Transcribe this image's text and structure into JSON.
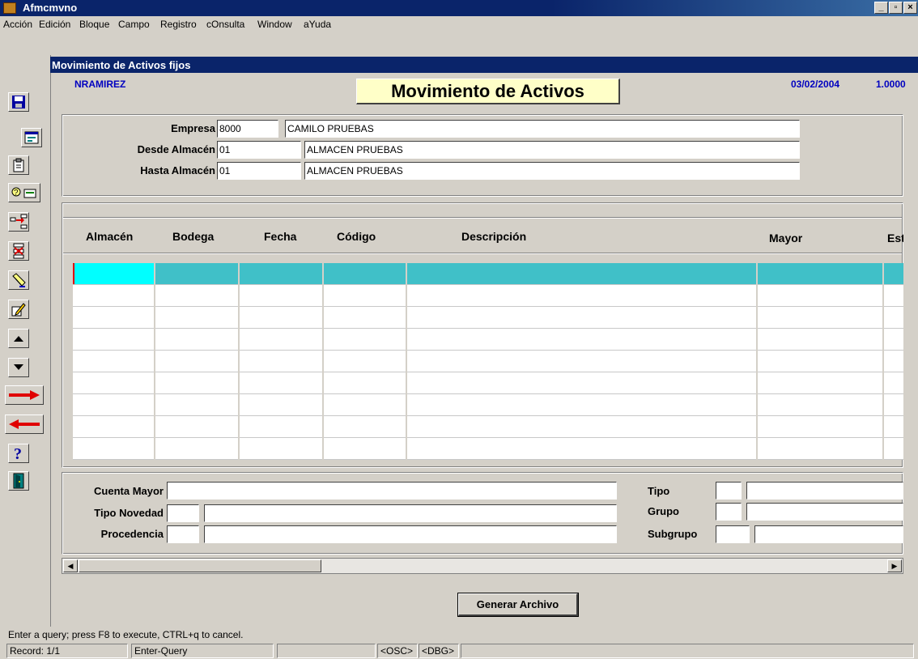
{
  "window": {
    "title": "Afmcmvno",
    "min": "_",
    "max": "▫",
    "close": "×"
  },
  "menu": [
    "Acción",
    "Edición",
    "Bloque",
    "Campo",
    "Registro",
    "cOnsulta",
    "Window",
    "aYuda"
  ],
  "form": {
    "title": "Movimiento de Activos fijos",
    "user": "NRAMIREZ",
    "heading": "Movimiento de Activos",
    "date": "03/02/2004",
    "version": "1.0000"
  },
  "header": {
    "empresa_label": "Empresa",
    "empresa_code": "8000",
    "empresa_name": "CAMILO PRUEBAS",
    "desde_label": "Desde Almacén",
    "desde_code": "01",
    "desde_name": "ALMACEN PRUEBAS",
    "hasta_label": "Hasta Almacén",
    "hasta_code": "01",
    "hasta_name": "ALMACEN PRUEBAS"
  },
  "grid": {
    "columns": [
      "Almacén",
      "Bodega",
      "Fecha",
      "Código",
      "Descripción",
      "Mayor",
      "Esta"
    ],
    "row_count": 9
  },
  "detail": {
    "cuenta_mayor": "Cuenta Mayor",
    "tipo_novedad": "Tipo Novedad",
    "procedencia": "Procedencia",
    "tipo": "Tipo",
    "grupo": "Grupo",
    "subgrupo": "Subgrupo"
  },
  "actions": {
    "generate": "Generar Archivo"
  },
  "status": {
    "message": "Enter a query;  press F8 to execute, CTRL+q  to cancel.",
    "record": "Record: 1/1",
    "mode": "Enter-Query",
    "osc": "<OSC>",
    "dbg": "<DBG>"
  },
  "colors": {
    "selected_row": "#40c0c8",
    "current_cell": "#00ffff",
    "title_blue": "#0a246a"
  }
}
